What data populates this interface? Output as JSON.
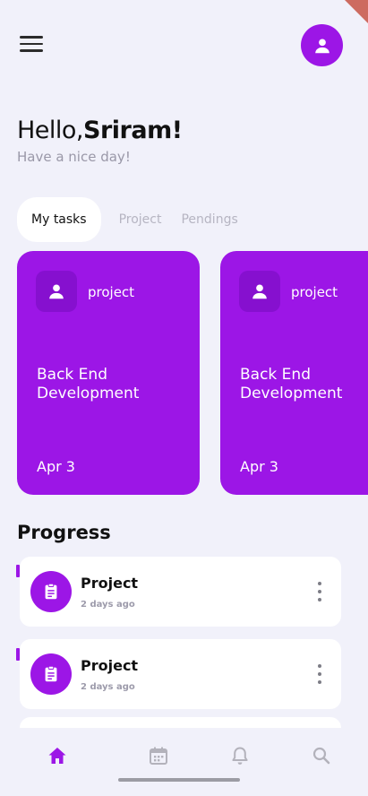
{
  "header": {
    "greeting_prefix": "Hello,",
    "user_name": "Sriram!",
    "subtitle": "Have a nice day!"
  },
  "tabs": [
    {
      "label": "My tasks",
      "active": true
    },
    {
      "label": "Project",
      "active": false
    },
    {
      "label": "Pendings",
      "active": false
    }
  ],
  "cards": [
    {
      "tag": "project",
      "title": "Back End Development",
      "date": "Apr 3"
    },
    {
      "tag": "project",
      "title": "Back End Development",
      "date": "Apr 3"
    }
  ],
  "progress": {
    "heading": "Progress",
    "items": [
      {
        "title": "Project",
        "time": "2 days ago",
        "icon": "clipboard-icon"
      },
      {
        "title": "Project",
        "time": "2 days ago",
        "icon": "clipboard-icon"
      }
    ]
  },
  "bottom_nav": [
    {
      "icon": "home-icon",
      "active": true
    },
    {
      "icon": "calendar-icon",
      "active": false
    },
    {
      "icon": "bell-icon",
      "active": false
    },
    {
      "icon": "search-icon",
      "active": false
    }
  ],
  "colors": {
    "accent": "#9c16e6",
    "accent_dark": "#8610cf",
    "background": "#f1f1fa",
    "muted_text": "#9a98a8",
    "nav_inactive": "#b3b2bb"
  }
}
